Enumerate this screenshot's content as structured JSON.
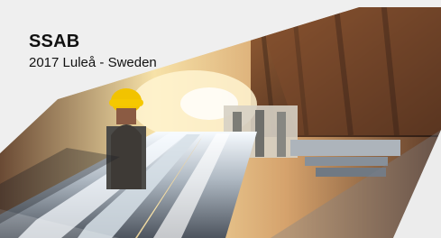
{
  "card": {
    "company": "SSAB",
    "subtitle": "2017 Luleå - Sweden",
    "image": {
      "description_name": "steel-factory-photo",
      "colors": {
        "background": "#ececec",
        "metal_light": "#e8edf0",
        "metal_dark": "#59606a",
        "warm_light": "#f6d48a",
        "rust": "#7a4a2a",
        "helmet": "#f2c300"
      }
    }
  }
}
